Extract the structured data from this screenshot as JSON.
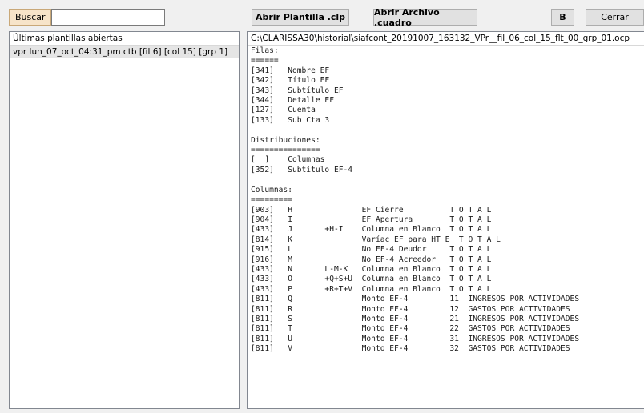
{
  "toolbar": {
    "search_label": "Buscar",
    "search_value": "",
    "open_template_label": "Abrir Plantilla .clp",
    "open_file_label": "Abrir Archivo .cuadro",
    "b_label": "B",
    "close_label": "Cerrar"
  },
  "left_panel": {
    "header": "Últimas plantillas abiertas",
    "items": [
      "vpr lun_07_oct_04:31_pm ctb [fil 6]  [col 15] [grp 1]"
    ]
  },
  "right_panel": {
    "path": "C:\\CLARISSA30\\historial\\siafcont_20191007_163132_VPr__fil_06_col_15_flt_00_grp_01.ocp",
    "content": "Filas:\n======\n[341]   Nombre EF\n[342]   Título EF\n[343]   Subtítulo EF\n[344]   Detalle EF\n[127]   Cuenta\n[133]   Sub Cta 3\n\nDistribuciones:\n===============\n[  ]    Columnas\n[352]   Subtítulo EF-4\n\nColumnas:\n=========\n[903]   H               EF Cierre          T O T A L\n[904]   I               EF Apertura        T O T A L\n[433]   J       +H-I    Columna en Blanco  T O T A L\n[814]   K               Varíac EF para HT E  T O T A L\n[915]   L               No EF-4 Deudor     T O T A L\n[916]   M               No EF-4 Acreedor   T O T A L\n[433]   N       L-M-K   Columna en Blanco  T O T A L\n[433]   O       +Q+S+U  Columna en Blanco  T O T A L\n[433]   P       +R+T+V  Columna en Blanco  T O T A L\n[811]   Q               Monto EF-4         11  INGRESOS POR ACTIVIDADES\n[811]   R               Monto EF-4         12  GASTOS POR ACTIVIDADES\n[811]   S               Monto EF-4         21  INGRESOS POR ACTIVIDADES\n[811]   T               Monto EF-4         22  GASTOS POR ACTIVIDADES\n[811]   U               Monto EF-4         31  INGRESOS POR ACTIVIDADES\n[811]   V               Monto EF-4         32  GASTOS POR ACTIVIDADES"
  }
}
